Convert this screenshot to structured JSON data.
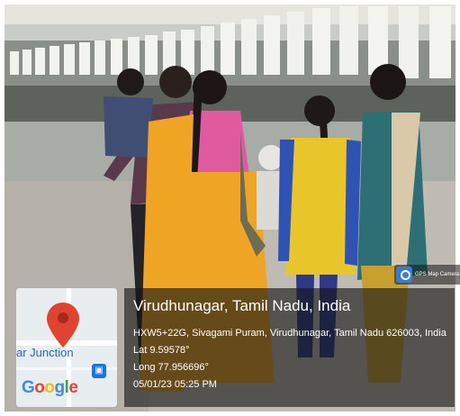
{
  "photo": {
    "description_icon": "photo-spinning-mill"
  },
  "overlay": {
    "badge_label": "GPS Map Camera",
    "badge_icon": "camera-icon",
    "map": {
      "street_label": "ar Junction",
      "logo_text": "Google",
      "pin_icon": "map-pin-icon",
      "transit_icon": "transit-icon"
    },
    "location": {
      "title": "Virudhunagar, Tamil Nadu, India",
      "address": "HXW5+22G, Sivagami Puram, Virudhunagar, Tamil Nadu 626003, India",
      "lat": "Lat 9.59578°",
      "long": "Long 77.956696°",
      "datetime": "05/01/23 05:25 PM"
    }
  },
  "colors": {
    "box_bg": "#141414",
    "saree_orange": "#f0a424",
    "dress_yellow": "#e8c62a",
    "blue_dupatta": "#2f53b5",
    "teal_kurta": "#2d6f74",
    "pin_red": "#e0442f"
  }
}
